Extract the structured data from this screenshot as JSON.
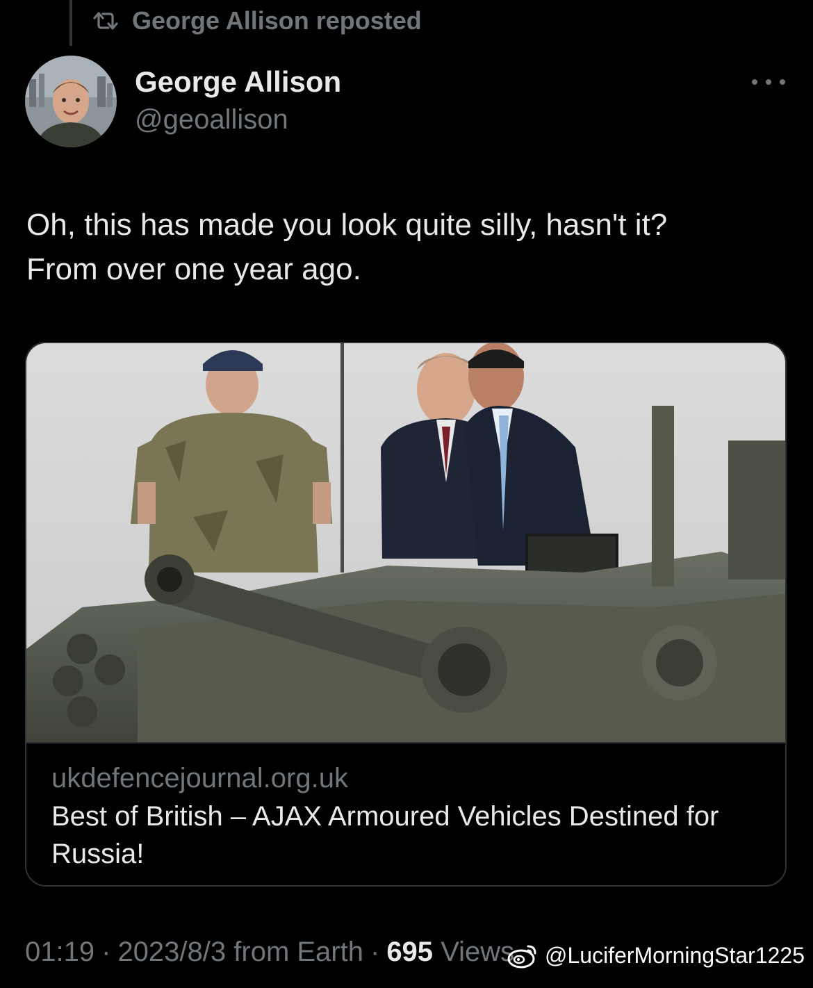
{
  "repost": {
    "text": "George Allison reposted",
    "icon": "repost-icon"
  },
  "author": {
    "name": "George Allison",
    "handle": "@geoallison"
  },
  "more": {
    "icon": "more-horizontal-icon"
  },
  "tweet": {
    "lines": [
      "Oh, this has made you look quite silly, hasn't it?",
      "From over one year ago."
    ]
  },
  "card": {
    "domain": "ukdefencejournal.org.uk",
    "title": "Best of British – AJAX Armoured Vehicles Destined for Russia!"
  },
  "meta": {
    "time": "01:19",
    "date": "2023/8/3",
    "source": "from Earth",
    "separator": "·",
    "views_count": "695",
    "views_label": "Views"
  },
  "watermark": {
    "text": "@LuciferMorningStar1225",
    "icon": "weibo-icon"
  },
  "colors": {
    "background": "#000000",
    "text_primary": "#e7e9ea",
    "text_secondary": "#71767b",
    "border": "#2f3336"
  }
}
